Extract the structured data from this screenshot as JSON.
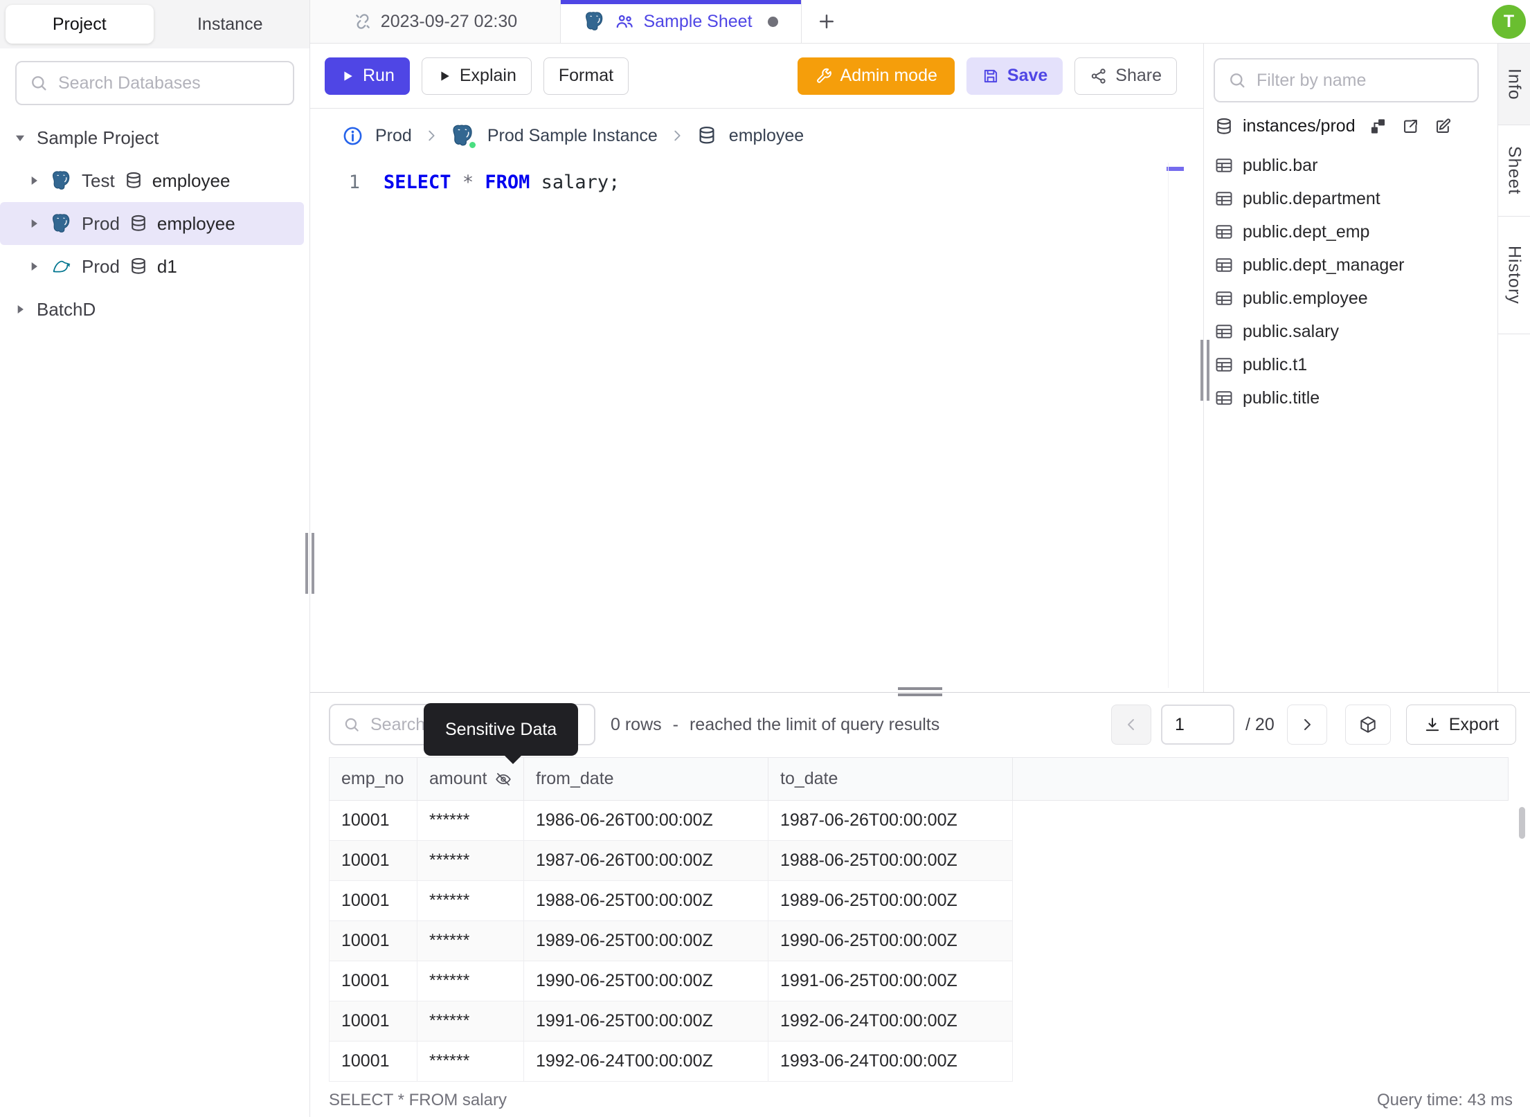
{
  "topbar": {
    "history_tab": "2023-09-27 02:30",
    "sheet_tab": "Sample Sheet",
    "avatar_initial": "T"
  },
  "sidebar": {
    "project_tab": "Project",
    "instance_tab": "Instance",
    "search_placeholder": "Search Databases",
    "tree": {
      "root_label": "Sample Project",
      "items": [
        {
          "env": "Test",
          "db": "employee",
          "engine": "postgres"
        },
        {
          "env": "Prod",
          "db": "employee",
          "engine": "postgres"
        },
        {
          "env": "Prod",
          "db": "d1",
          "engine": "mysql"
        }
      ],
      "batch_label": "BatchD"
    }
  },
  "toolbar": {
    "run_label": "Run",
    "explain_label": "Explain",
    "format_label": "Format",
    "admin_mode_label": "Admin mode",
    "save_label": "Save",
    "share_label": "Share"
  },
  "breadcrumb": {
    "environment": "Prod",
    "instance": "Prod Sample Instance",
    "database": "employee"
  },
  "editor": {
    "line_number": "1",
    "keyword_select": "SELECT",
    "star": "*",
    "keyword_from": "FROM",
    "identifier": " salary;"
  },
  "schema_panel": {
    "filter_placeholder": "Filter by name",
    "database_path": "instances/prod",
    "tables": [
      "public.bar",
      "public.department",
      "public.dept_emp",
      "public.dept_manager",
      "public.employee",
      "public.salary",
      "public.t1",
      "public.title"
    ]
  },
  "side_tabs": {
    "info": "Info",
    "sheet": "Sheet",
    "history": "History"
  },
  "results": {
    "search_placeholder": "Search",
    "tooltip_label": "Sensitive Data",
    "rows_count": "0 rows",
    "separator": "-",
    "limit_message": "reached the limit of query results",
    "page_value": "1",
    "page_total": "/ 20",
    "export_label": "Export",
    "status_query": "SELECT * FROM salary",
    "query_time": "Query time: 43 ms",
    "table": {
      "columns": [
        "emp_no",
        "amount",
        "from_date",
        "to_date"
      ],
      "masked_column_index": 1,
      "rows": [
        [
          "10001",
          "******",
          "1986-06-26T00:00:00Z",
          "1987-06-26T00:00:00Z"
        ],
        [
          "10001",
          "******",
          "1987-06-26T00:00:00Z",
          "1988-06-25T00:00:00Z"
        ],
        [
          "10001",
          "******",
          "1988-06-25T00:00:00Z",
          "1989-06-25T00:00:00Z"
        ],
        [
          "10001",
          "******",
          "1989-06-25T00:00:00Z",
          "1990-06-25T00:00:00Z"
        ],
        [
          "10001",
          "******",
          "1990-06-25T00:00:00Z",
          "1991-06-25T00:00:00Z"
        ],
        [
          "10001",
          "******",
          "1991-06-25T00:00:00Z",
          "1992-06-24T00:00:00Z"
        ],
        [
          "10001",
          "******",
          "1992-06-24T00:00:00Z",
          "1993-06-24T00:00:00Z"
        ]
      ]
    }
  },
  "icons": {
    "search-icon": "magnifier",
    "unlink-icon": "broken chain link",
    "postgres-icon": "postgresql elephant",
    "mysql-icon": "mysql dolphin",
    "database-icon": "db cylinder",
    "users-icon": "people group",
    "play-icon": "filled triangle",
    "wrench-icon": "wrench",
    "save-icon": "floppy disk",
    "share-icon": "share nodes",
    "info-icon": "circled i",
    "table-icon": "table grid",
    "diagram-icon": "schema diagram",
    "external-link-icon": "box with arrow",
    "edit-icon": "pencil square",
    "eye-off-icon": "crossed eye (masked column)",
    "cube-icon": "3d box",
    "download-icon": "download arrow"
  },
  "colors": {
    "accent_indigo": "#4f46e5",
    "admin_amber": "#f59e0b",
    "avatar_green": "#6abe30",
    "keyword_blue": "#0000f0",
    "postgres_blue": "#336791",
    "mysql_teal": "#00758f",
    "tooltip_bg": "#202024",
    "selected_row_bg": "#e9e6f9",
    "status_green": "#4ade80"
  }
}
